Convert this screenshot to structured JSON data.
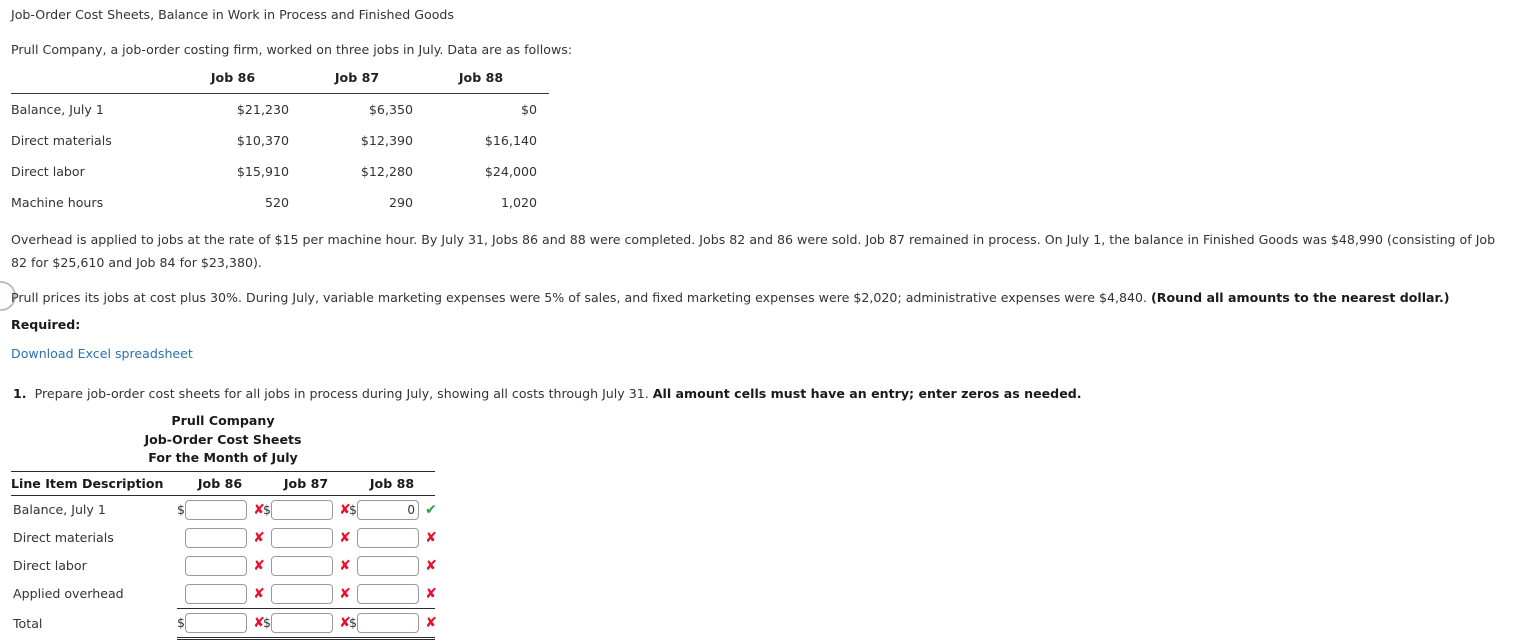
{
  "header": {
    "title": "Job-Order Cost Sheets, Balance in Work in Process and Finished Goods",
    "intro": "Prull Company, a job-order costing firm, worked on three jobs in July. Data are as follows:"
  },
  "data_table": {
    "columns": [
      "",
      "Job 86",
      "Job 87",
      "Job 88"
    ],
    "rows": [
      {
        "label": "Balance, July 1",
        "job86": "$21,230",
        "job87": "$6,350",
        "job88": "$0"
      },
      {
        "label": "Direct materials",
        "job86": "$10,370",
        "job87": "$12,390",
        "job88": "$16,140"
      },
      {
        "label": "Direct labor",
        "job86": "$15,910",
        "job87": "$12,280",
        "job88": "$24,000"
      },
      {
        "label": "Machine hours",
        "job86": "520",
        "job87": "290",
        "job88": "1,020"
      }
    ]
  },
  "paragraphs": {
    "overhead": "Overhead is applied to jobs at the rate of $15 per machine hour. By July 31, Jobs 86 and 88 were completed. Jobs 82 and 86 were sold. Job 87 remained in process. On July 1, the balance in Finished Goods was $48,990 (consisting of Job 82 for $25,610 and Job 84 for $23,380).",
    "prices_plain": "Prull prices its jobs at cost plus 30%. During July, variable marketing expenses were 5% of sales, and fixed marketing expenses were $2,020; administrative expenses were $4,840. ",
    "prices_bold": "(Round all amounts to the nearest dollar.)"
  },
  "required": {
    "label": "Required:",
    "download_link": "Download Excel spreadsheet",
    "item_number": "1.",
    "item_plain": "Prepare job-order cost sheets for all jobs in process during July, showing all costs through July 31. ",
    "item_bold": "All amount cells must have an entry; enter zeros as needed."
  },
  "form": {
    "heading_line1": "Prull Company",
    "heading_line2": "Job-Order Cost Sheets",
    "heading_line3": "For the Month of July",
    "columns": [
      "Line Item Description",
      "Job 86",
      "Job 87",
      "Job 88"
    ],
    "rows": [
      {
        "label": "Balance, July 1",
        "is_total": false,
        "cells": [
          {
            "currency": "$",
            "value": "",
            "mark": "wrong",
            "mark_glyph": "✘"
          },
          {
            "currency": "$",
            "value": "",
            "mark": "wrong",
            "mark_glyph": "✘"
          },
          {
            "currency": "$",
            "value": "0",
            "mark": "right",
            "mark_glyph": "✔"
          }
        ]
      },
      {
        "label": "Direct materials",
        "is_total": false,
        "cells": [
          {
            "currency": "",
            "value": "",
            "mark": "wrong",
            "mark_glyph": "✘"
          },
          {
            "currency": "",
            "value": "",
            "mark": "wrong",
            "mark_glyph": "✘"
          },
          {
            "currency": "",
            "value": "",
            "mark": "wrong",
            "mark_glyph": "✘"
          }
        ]
      },
      {
        "label": "Direct labor",
        "is_total": false,
        "cells": [
          {
            "currency": "",
            "value": "",
            "mark": "wrong",
            "mark_glyph": "✘"
          },
          {
            "currency": "",
            "value": "",
            "mark": "wrong",
            "mark_glyph": "✘"
          },
          {
            "currency": "",
            "value": "",
            "mark": "wrong",
            "mark_glyph": "✘"
          }
        ]
      },
      {
        "label": "Applied overhead",
        "is_total": false,
        "cells": [
          {
            "currency": "",
            "value": "",
            "mark": "wrong",
            "mark_glyph": "✘"
          },
          {
            "currency": "",
            "value": "",
            "mark": "wrong",
            "mark_glyph": "✘"
          },
          {
            "currency": "",
            "value": "",
            "mark": "wrong",
            "mark_glyph": "✘"
          }
        ]
      },
      {
        "label": "Total",
        "is_total": true,
        "cells": [
          {
            "currency": "$",
            "value": "",
            "mark": "wrong",
            "mark_glyph": "✘"
          },
          {
            "currency": "$",
            "value": "",
            "mark": "wrong",
            "mark_glyph": "✘"
          },
          {
            "currency": "$",
            "value": "",
            "mark": "wrong",
            "mark_glyph": "✘"
          }
        ]
      }
    ]
  },
  "colors": {
    "link": "#2f6fad",
    "wrong": "#e8112d",
    "right": "#2e9e3e",
    "text": "#333333",
    "rule": "#2b2b2b"
  }
}
